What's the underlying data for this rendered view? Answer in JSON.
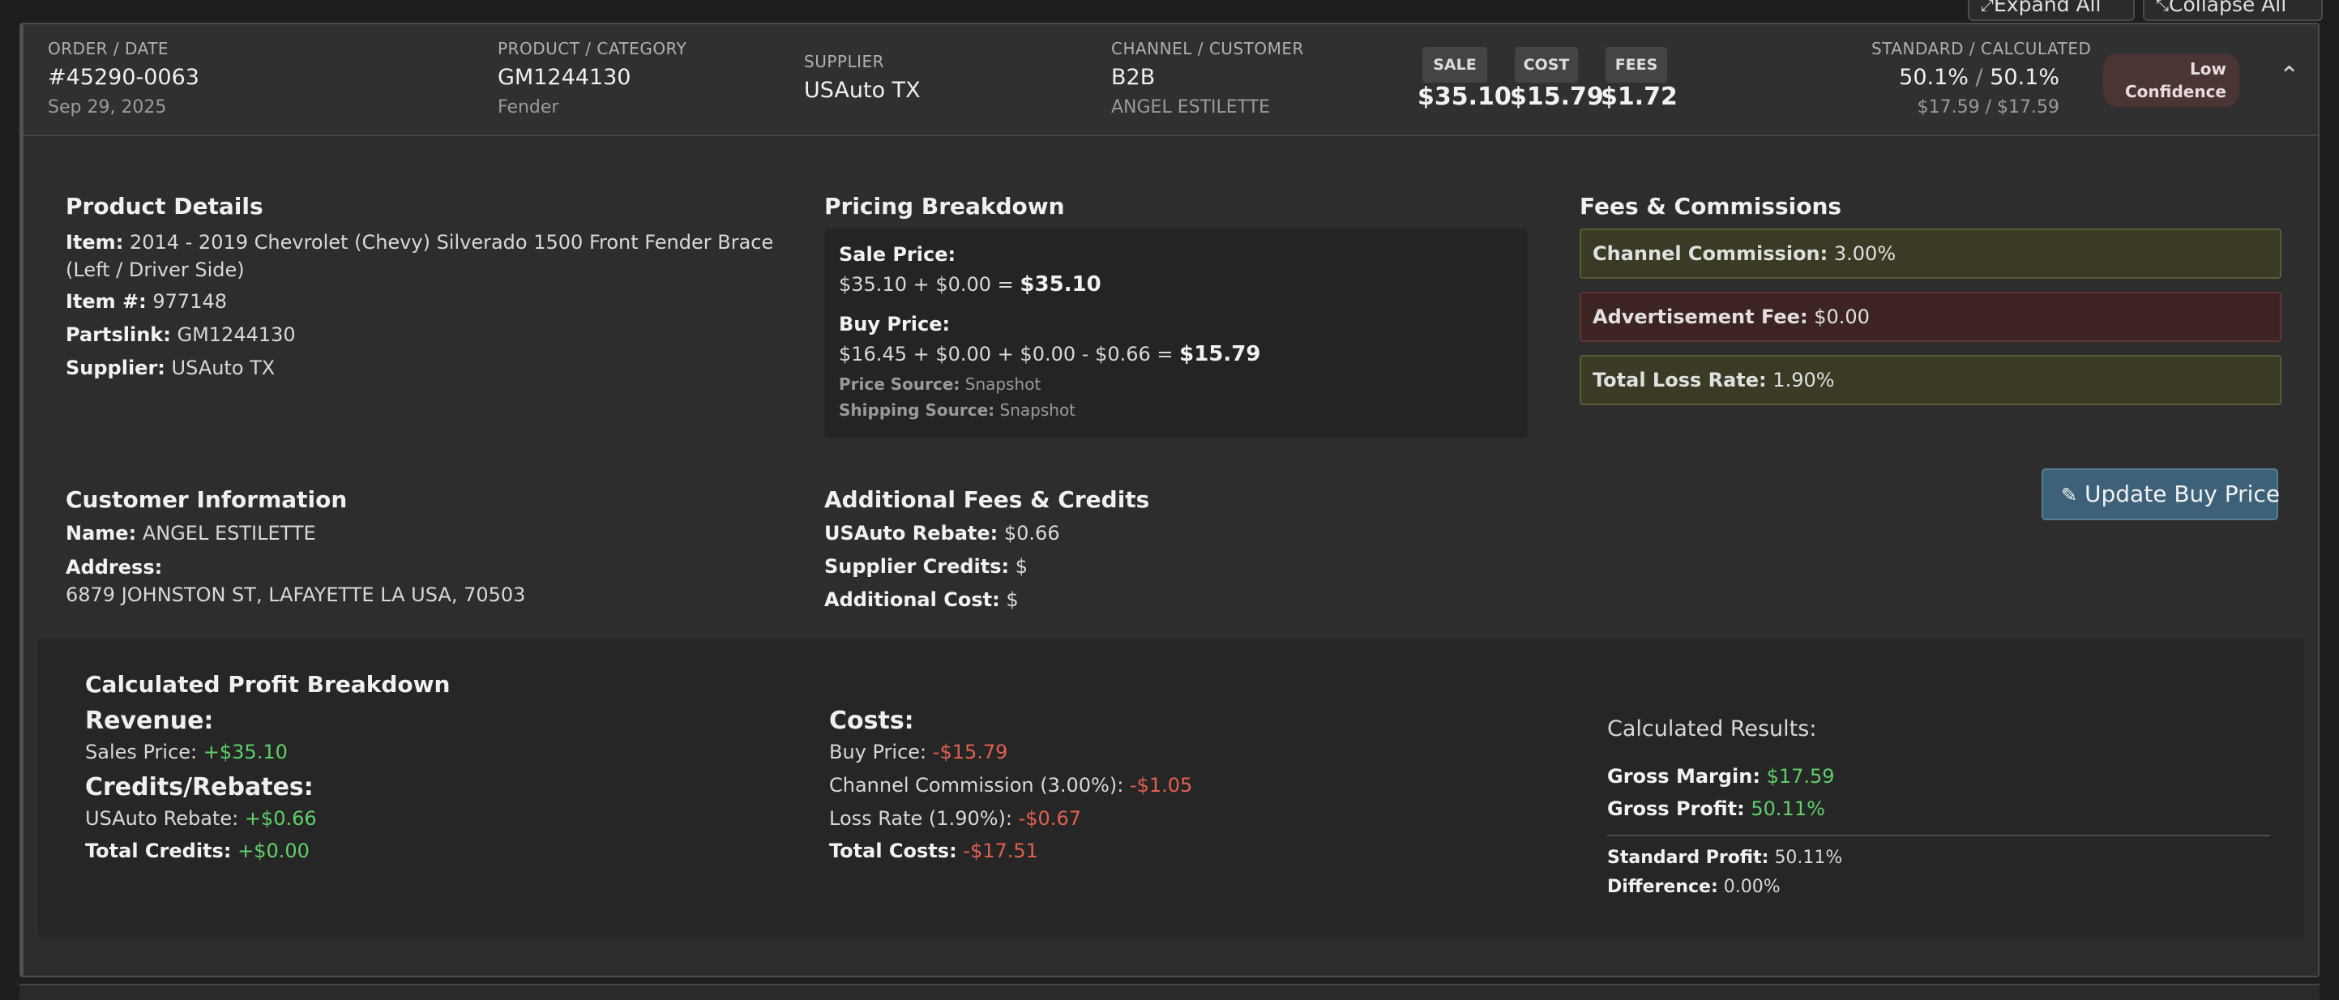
{
  "toolbar": {
    "expand_all": "Expand All",
    "collapse_all": "Collapse All"
  },
  "header": {
    "order_label": "ORDER / DATE",
    "order_number": "#45290-0063",
    "order_date": "Sep 29, 2025",
    "product_label": "PRODUCT / CATEGORY",
    "product": "GM1244130",
    "category": "Fender",
    "supplier_label": "SUPPLIER",
    "supplier": "USAuto TX",
    "channel_label": "CHANNEL / CUSTOMER",
    "channel": "B2B",
    "customer": "ANGEL ESTILETTE",
    "sale_label": "SALE",
    "sale": "$35.10",
    "cost_label": "COST",
    "cost": "$15.79",
    "fees_label": "FEES",
    "fees": "$1.72",
    "standard_label": "STANDARD / CALCULATED",
    "standard_pct": "50.1%",
    "calculated_pct": "50.1%",
    "slash": "/",
    "standard_amt": "$17.59",
    "calculated_amt": "$17.59",
    "confidence_line1": "Low",
    "confidence_line2": "Confidence"
  },
  "product_details": {
    "title": "Product Details",
    "item_label": "Item:",
    "item": "2014 - 2019 Chevrolet (Chevy) Silverado 1500 Front Fender Brace (Left / Driver Side)",
    "item_no_label": "Item #:",
    "item_no": "977148",
    "partslink_label": "Partslink:",
    "partslink": "GM1244130",
    "supplier_label": "Supplier:",
    "supplier": "USAuto TX"
  },
  "pricing": {
    "title": "Pricing Breakdown",
    "sale_label": "Sale Price:",
    "sale_formula": "$35.10 + $0.00 = ",
    "sale_total": "$35.10",
    "buy_label": "Buy Price:",
    "buy_formula": "$16.45 + $0.00 + $0.00 - $0.66 = ",
    "buy_total": "$15.79",
    "price_source_label": "Price Source:",
    "price_source": "Snapshot",
    "shipping_source_label": "Shipping Source:",
    "shipping_source": "Snapshot"
  },
  "fees": {
    "title": "Fees & Commissions",
    "channel_label": "Channel Commission:",
    "channel": "3.00%",
    "ad_label": "Advertisement Fee:",
    "ad": "$0.00",
    "loss_label": "Total Loss Rate:",
    "loss": "1.90%"
  },
  "customer": {
    "title": "Customer Information",
    "name_label": "Name:",
    "name": "ANGEL ESTILETTE",
    "address_label": "Address:",
    "address": "6879 JOHNSTON ST, LAFAYETTE LA USA, 70503"
  },
  "additional": {
    "title": "Additional Fees & Credits",
    "rebate_label": "USAuto Rebate:",
    "rebate": "$0.66",
    "supplier_credits_label": "Supplier Credits:",
    "supplier_credits": "$",
    "additional_cost_label": "Additional Cost:",
    "additional_cost": "$"
  },
  "update_button": "Update Buy Price",
  "profit": {
    "title": "Calculated Profit Breakdown",
    "revenue_title": "Revenue:",
    "sales_label": "Sales Price:",
    "sales": "+$35.10",
    "credits_title": "Credits/Rebates:",
    "rebate_label": "USAuto Rebate:",
    "rebate": "+$0.66",
    "total_credits_label": "Total Credits:",
    "total_credits": "+$0.00",
    "costs_title": "Costs:",
    "buy_label": "Buy Price:",
    "buy": "-$15.79",
    "commission_label": "Channel Commission (3.00%):",
    "commission": "-$1.05",
    "loss_label": "Loss Rate (1.90%):",
    "loss": "-$0.67",
    "total_costs_label": "Total Costs:",
    "total_costs": "-$17.51",
    "results_title": "Calculated Results:",
    "gross_margin_label": "Gross Margin:",
    "gross_margin": "$17.59",
    "gross_profit_label": "Gross Profit:",
    "gross_profit": "50.11%",
    "standard_profit_label": "Standard Profit:",
    "standard_profit": "50.11%",
    "difference_label": "Difference:",
    "difference": "0.00%"
  },
  "colors": {
    "positive": "#5fcf6a",
    "negative": "#e06050",
    "accent_button": "#3d6178",
    "confidence_badge": "#4a3434"
  },
  "icons": {
    "expand": "expand-arrow-icon",
    "collapse": "collapse-arrow-icon",
    "chevron": "chevron-up-icon",
    "edit": "edit-icon"
  }
}
